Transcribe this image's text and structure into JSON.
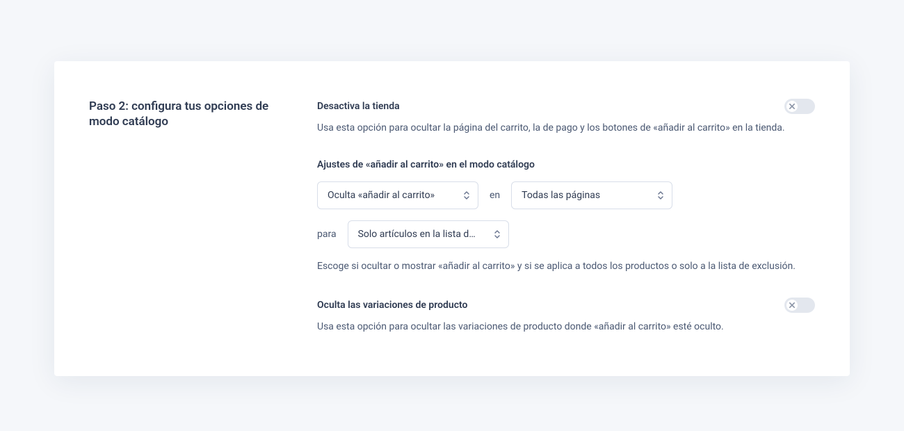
{
  "step": {
    "title": "Paso 2: configura tus opciones de modo catálogo"
  },
  "sections": {
    "disable_shop": {
      "title": "Desactiva la tienda",
      "description": "Usa esta opción para ocultar la página del carrito, la de pago y los botones de «añadir al carrito» en la tienda."
    },
    "add_to_cart": {
      "title": "Ajustes de «añadir al carrito» en el modo catálogo",
      "select_action": "Oculta «añadir al carrito»",
      "connector_on": "en",
      "select_pages": "Todas las páginas",
      "connector_for": "para",
      "select_items": "Solo artículos en la lista d…",
      "description": "Escoge si ocultar o mostrar «añadir al carrito» y si se aplica a todos los productos o solo a la lista de exclusión."
    },
    "variations": {
      "title": "Oculta las variaciones de producto",
      "description": "Usa esta opción para ocultar las variaciones de producto donde «añadir al carrito» esté oculto."
    }
  }
}
